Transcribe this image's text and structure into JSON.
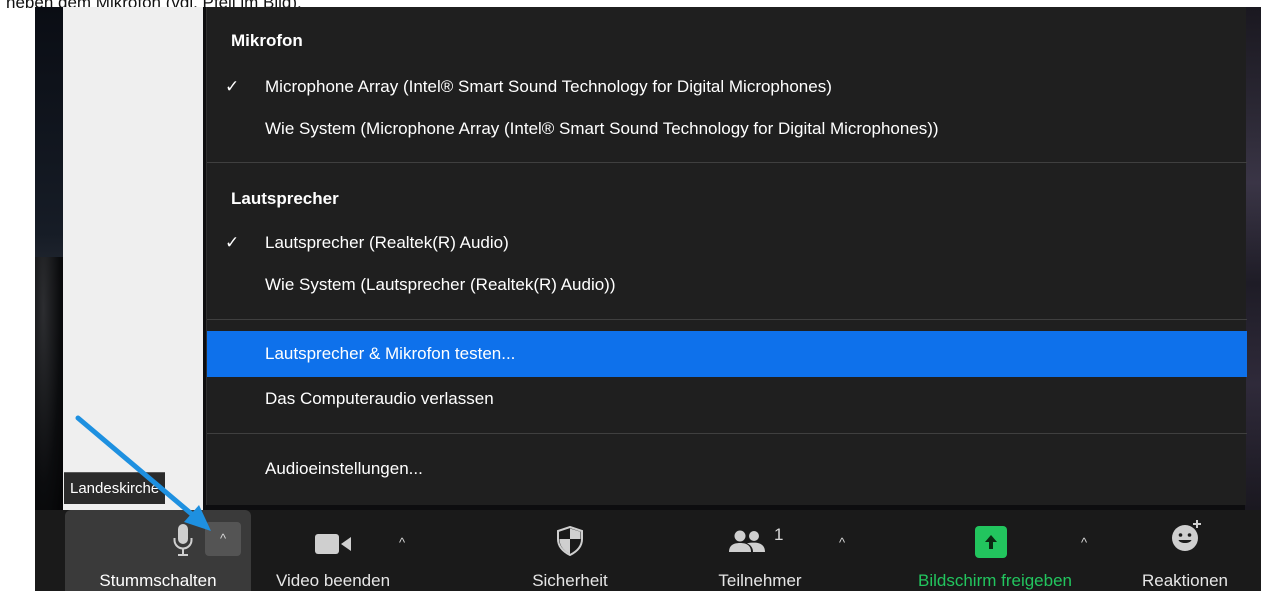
{
  "caption": "neben dem Mikrofon (vgl. Pfeil im Bild).",
  "participant_label": "Landeskirche",
  "menu": {
    "sections": [
      {
        "title": "Mikrofon",
        "items": [
          {
            "label": "Microphone Array (Intel® Smart Sound Technology for Digital Microphones)",
            "checked": true
          },
          {
            "label": "Wie System (Microphone Array (Intel® Smart Sound Technology for Digital Microphones))",
            "checked": false
          }
        ]
      },
      {
        "title": "Lautsprecher",
        "items": [
          {
            "label": "Lautsprecher (Realtek(R) Audio)",
            "checked": true
          },
          {
            "label": "Wie System (Lautsprecher (Realtek(R) Audio))",
            "checked": false
          }
        ]
      }
    ],
    "actions": [
      {
        "label": "Lautsprecher & Mikrofon testen...",
        "highlighted": true
      },
      {
        "label": "Das Computeraudio verlassen",
        "highlighted": false
      }
    ],
    "settings_label": "Audioeinstellungen...",
    "check_glyph": "✓"
  },
  "toolbar": {
    "mute_label": "Stummschalten",
    "video_label": "Video beenden",
    "security_label": "Sicherheit",
    "participants_label": "Teilnehmer",
    "participants_count": "1",
    "share_label": "Bildschirm freigeben",
    "reactions_label": "Reaktionen",
    "caret_glyph": "^"
  },
  "icons": {
    "microphone": "microphone-icon",
    "video": "video-camera-icon",
    "security": "shield-icon",
    "participants": "people-icon",
    "share": "share-screen-icon",
    "reactions": "smiley-icon",
    "caret": "chevron-up-icon",
    "annotation": "blue-arrow-icon"
  },
  "colors": {
    "menu_bg": "#1f1f1f",
    "highlight": "#0e71eb",
    "share_green": "#22c55e",
    "toolbar_bg": "#1a1a1a",
    "annotation_arrow": "#1e90e0"
  }
}
